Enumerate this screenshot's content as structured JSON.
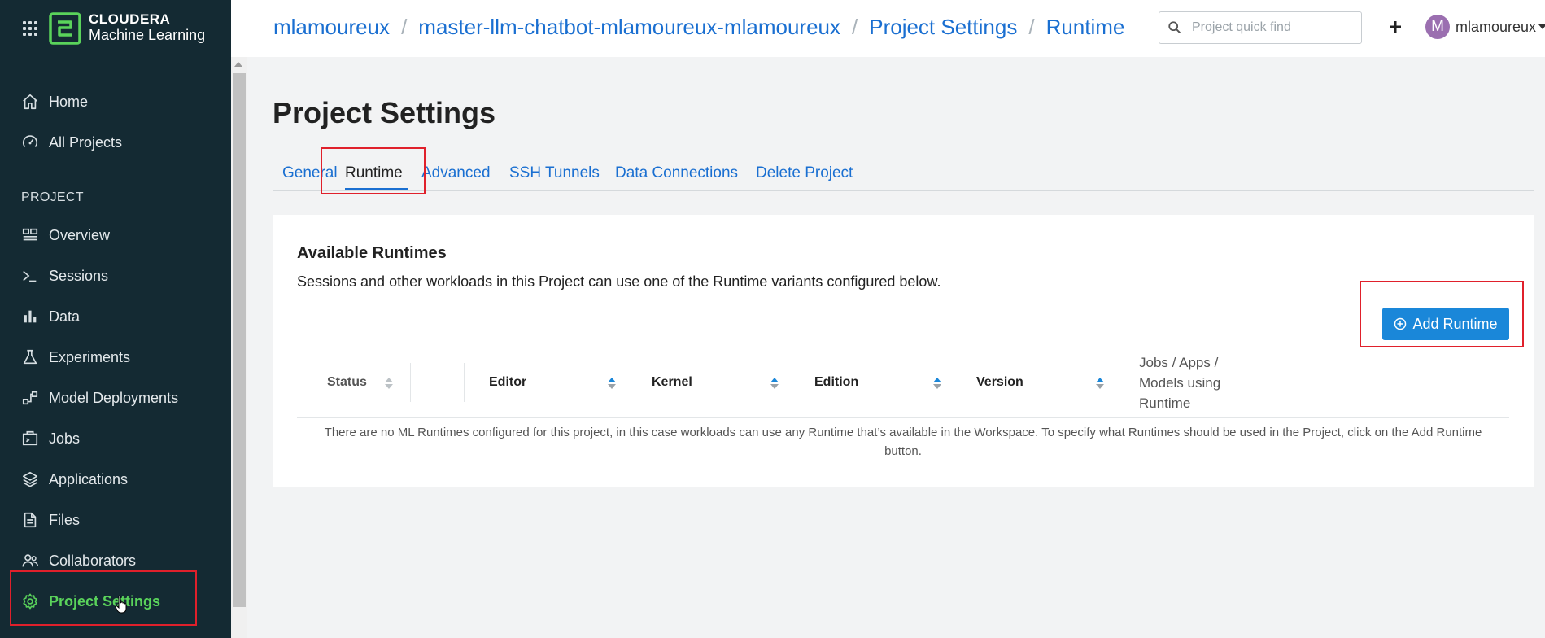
{
  "brand": {
    "name": "CLOUDERA",
    "product": "Machine Learning"
  },
  "sidebar": {
    "main_items": [
      {
        "label": "Home",
        "icon": "home-icon"
      },
      {
        "label": "All Projects",
        "icon": "gauge-icon"
      }
    ],
    "section_label": "PROJECT",
    "project_items": [
      {
        "label": "Overview",
        "icon": "overview-icon"
      },
      {
        "label": "Sessions",
        "icon": "terminal-icon"
      },
      {
        "label": "Data",
        "icon": "bar-chart-icon"
      },
      {
        "label": "Experiments",
        "icon": "flask-icon"
      },
      {
        "label": "Model Deployments",
        "icon": "model-icon"
      },
      {
        "label": "Jobs",
        "icon": "jobs-icon"
      },
      {
        "label": "Applications",
        "icon": "layers-icon"
      },
      {
        "label": "Files",
        "icon": "file-icon"
      },
      {
        "label": "Collaborators",
        "icon": "users-icon"
      },
      {
        "label": "Project Settings",
        "icon": "gear-icon",
        "active": true
      }
    ],
    "active_color": "#5ad35b"
  },
  "breadcrumb": [
    "mlamoureux",
    "master-llm-chatbot-mlamoureux-mlamoureux",
    "Project Settings",
    "Runtime"
  ],
  "search": {
    "placeholder": "Project quick find",
    "value": ""
  },
  "user": {
    "initial": "M",
    "name": "mlamoureux"
  },
  "page": {
    "title": "Project Settings",
    "tabs": [
      {
        "label": "General"
      },
      {
        "label": "Runtime",
        "active": true
      },
      {
        "label": "Advanced"
      },
      {
        "label": "SSH Tunnels"
      },
      {
        "label": "Data Connections"
      },
      {
        "label": "Delete Project"
      }
    ]
  },
  "runtimes": {
    "title": "Available Runtimes",
    "description": "Sessions and other workloads in this Project can use one of the Runtime variants configured below.",
    "add_button": "Add Runtime",
    "columns": [
      "Status",
      "Editor",
      "Kernel",
      "Edition",
      "Version",
      "Jobs / Apps / Models using Runtime"
    ],
    "empty_message": "There are no ML Runtimes configured for this project, in this case workloads can use any Runtime that’s available in the Workspace. To specify what Runtimes should be used in the Project, click on the Add Runtime button."
  },
  "colors": {
    "sidebar_bg": "#142a33",
    "link": "#1a6fd1",
    "button": "#1a87d9",
    "highlight": "#e0202b"
  }
}
